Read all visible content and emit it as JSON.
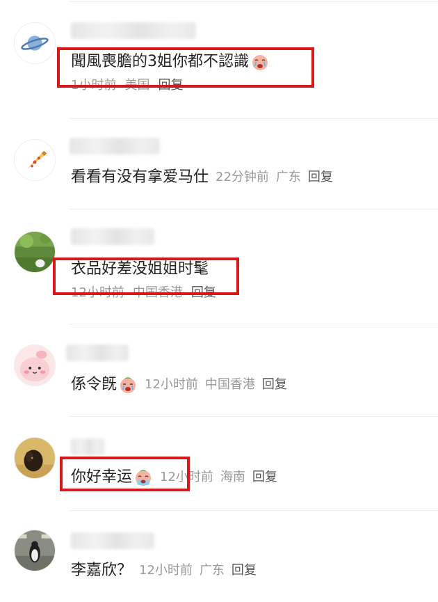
{
  "comments": [
    {
      "avatar": "planet-icon",
      "text": "聞風喪膽的3姐你都不認識",
      "emoji": "crying-face-emoji",
      "time": "1小时前",
      "location": "美国",
      "reply": "回复",
      "highlighted": true
    },
    {
      "avatar": "pizza-icon",
      "text": "看看有没有拿爱马仕",
      "time": "22分钟前",
      "location": "广东",
      "reply": "回复",
      "highlighted": false
    },
    {
      "avatar": "green-field-photo",
      "text": "衣品好差没姐姐时髦",
      "time": "12小时前",
      "location": "中国香港",
      "reply": "回复",
      "highlighted": true
    },
    {
      "avatar": "pink-cartoon-face",
      "text": "係令旣",
      "emoji": "crying-face-emoji",
      "time": "12小时前",
      "location": "中国香港",
      "reply": "回复",
      "highlighted": false
    },
    {
      "avatar": "dog-photo",
      "text": "你好幸运",
      "emoji": "crying-face-emoji",
      "time": "12小时前",
      "location": "海南",
      "reply": "回复",
      "highlighted": true
    },
    {
      "avatar": "penguin-photo",
      "text": "李嘉欣？",
      "time": "12小时前",
      "location": "广东",
      "reply": "回复",
      "highlighted": false
    }
  ],
  "colors": {
    "highlight_border": "#d81818",
    "meta_text": "#9a9a9a",
    "body_text": "#222222"
  }
}
